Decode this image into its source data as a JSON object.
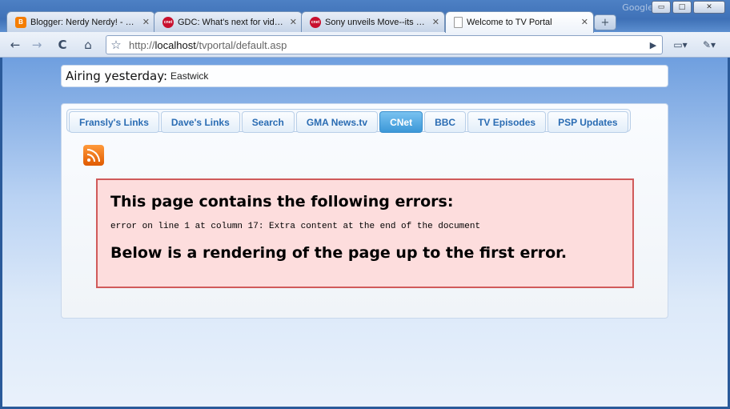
{
  "window": {
    "brand_ghost": "Google",
    "controls": {
      "minimize": "▭",
      "maximize": "□",
      "close": "✕"
    }
  },
  "tabs": [
    {
      "title": "Blogger: Nerdy Nerdy! - Cr...",
      "favicon": "blogger-icon",
      "active": false
    },
    {
      "title": "GDC: What's next for vide...",
      "favicon": "cnet-icon",
      "active": false
    },
    {
      "title": "Sony unveils Move--its PS3...",
      "favicon": "cnet-icon",
      "active": false
    },
    {
      "title": "Welcome to TV Portal",
      "favicon": "page-icon",
      "active": true
    }
  ],
  "tab_close_glyph": "✕",
  "new_tab_glyph": "+",
  "toolbar": {
    "back": "←",
    "forward": "→",
    "reload": "C",
    "home": "⌂",
    "star": "☆",
    "url_prefix": "http://",
    "url_host": "localhost",
    "url_path": "/tvportal/default.asp",
    "go": "▶",
    "page_menu": "▭▾",
    "wrench_menu": "✎▾"
  },
  "airing": {
    "label": "Airing yesterday:",
    "value": "Eastwick"
  },
  "nav": {
    "tabs": [
      "Fransly's Links",
      "Dave's Links",
      "Search",
      "GMA News.tv",
      "CNet",
      "BBC",
      "TV Episodes",
      "PSP Updates"
    ],
    "active": "CNet"
  },
  "error": {
    "heading": "This page contains the following errors:",
    "message": "error on line 1 at column 17: Extra content at the end of the document",
    "rendering": "Below is a rendering of the page up to the first error."
  }
}
